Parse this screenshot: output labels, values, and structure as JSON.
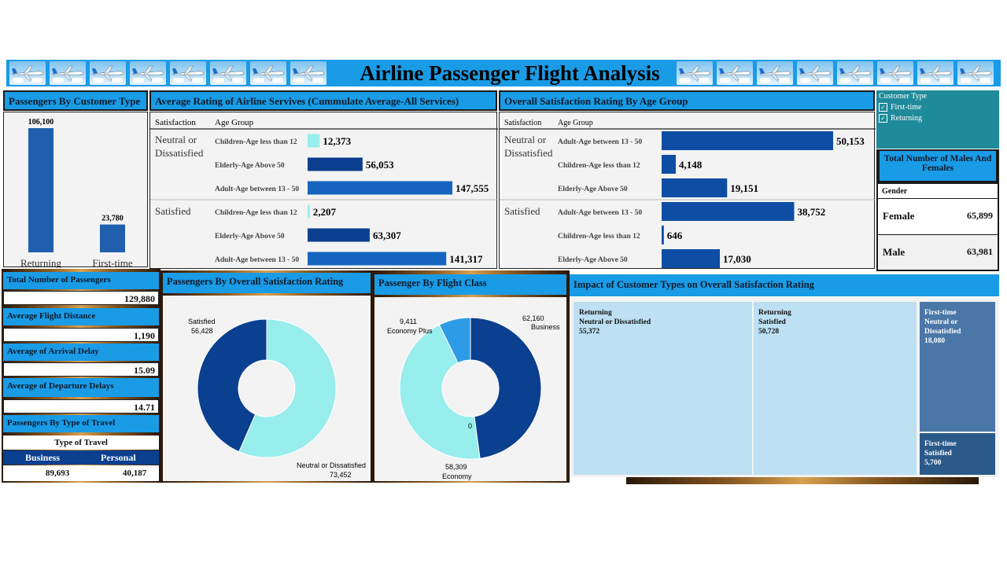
{
  "title": "Airline Passenger Flight Analysis",
  "panels": {
    "customer_type": "Passengers By Customer Type",
    "services": "Average Rating of Airline Servives (Cummulate Average-All Services)",
    "age_group": "Overall Satisfaction Rating By Age Group",
    "total_passengers": "Total Number of Passengers",
    "avg_distance": "Average Flight Distance",
    "avg_arrival": "Average of Arrival Delay",
    "avg_departure": "Average of Departure Delays",
    "type_travel": "Passengers By Type of Travel",
    "overall_sat": "Passengers By Overall Satisfaction Rating",
    "flight_class": "Passenger By Flight Class",
    "impact": "Impact of Customer Types on Overall Satisfaction Rating",
    "gender": "Total Number of Males And Females"
  },
  "kpis": {
    "total_passengers": "129,880",
    "avg_distance": "1,190",
    "avg_arrival": "15.09",
    "avg_departure": "14.71"
  },
  "filter": {
    "title": "Customer Type",
    "options": [
      "First-time",
      "Returning"
    ],
    "check": "✓"
  },
  "gender": {
    "header": "Gender",
    "rows": [
      {
        "label": "Female",
        "value": "65,899"
      },
      {
        "label": "Male",
        "value": "63,981"
      }
    ]
  },
  "type_travel": {
    "header": "Type of Travel",
    "cols": [
      "Business",
      "Personal"
    ],
    "values": [
      "89,693",
      "40,187"
    ]
  },
  "colors": {
    "accent": "#1a9be6",
    "dark_blue": "#0b3f8f",
    "mid_blue": "#1565c0",
    "light_cyan": "#98eded",
    "sky": "#2e9be6",
    "tile_light": "#bde0f2",
    "tile_mid": "#4a77a8",
    "tile_dark": "#2b5a8a"
  },
  "chart_data": [
    {
      "id": "customer_type",
      "type": "bar",
      "categories": [
        "Returning",
        "First-time"
      ],
      "values": [
        106100,
        23780
      ],
      "labels": [
        "106,100",
        "23,780"
      ],
      "ylim": [
        0,
        106100
      ]
    },
    {
      "id": "services",
      "type": "bar",
      "orientation": "horizontal",
      "col_headers": [
        "Satisfaction",
        "Age Group"
      ],
      "groups": [
        "Neutral or Dissatisfied",
        "Satisfied"
      ],
      "rows": [
        {
          "group": 0,
          "category": "Children-Age less than 12",
          "value": 12373,
          "label": "12,373",
          "color": "#98eded"
        },
        {
          "group": 0,
          "category": "Elderly-Age Above 50",
          "value": 56053,
          "label": "56,053",
          "color": "#0b3f8f"
        },
        {
          "group": 0,
          "category": "Adult-Age between 13 - 50",
          "value": 147555,
          "label": "147,555",
          "color": "#1565c0"
        },
        {
          "group": 1,
          "category": "Children-Age less than 12",
          "value": 2207,
          "label": "2,207",
          "color": "#98eded"
        },
        {
          "group": 1,
          "category": "Elderly-Age Above 50",
          "value": 63307,
          "label": "63,307",
          "color": "#0b3f8f"
        },
        {
          "group": 1,
          "category": "Adult-Age between 13 - 50",
          "value": 141317,
          "label": "141,317",
          "color": "#1565c0"
        }
      ],
      "xlim": [
        0,
        147555
      ]
    },
    {
      "id": "age_group",
      "type": "bar",
      "orientation": "horizontal",
      "col_headers": [
        "Satisfaction",
        "Age Group"
      ],
      "groups": [
        "Neutral or Dissatisfied",
        "Satisfied"
      ],
      "rows": [
        {
          "group": 0,
          "category": "Adult-Age between 13 - 50",
          "value": 50153,
          "label": "50,153"
        },
        {
          "group": 0,
          "category": "Children-Age less than 12",
          "value": 4148,
          "label": "4,148"
        },
        {
          "group": 0,
          "category": "Elderly-Age Above 50",
          "value": 19151,
          "label": "19,151"
        },
        {
          "group": 1,
          "category": "Adult-Age between 13 - 50",
          "value": 38752,
          "label": "38,752"
        },
        {
          "group": 1,
          "category": "Children-Age less than 12",
          "value": 646,
          "label": "646"
        },
        {
          "group": 1,
          "category": "Elderly-Age Above 50",
          "value": 17030,
          "label": "17,030"
        }
      ],
      "xlim": [
        0,
        50153
      ]
    },
    {
      "id": "overall_sat",
      "type": "pie",
      "donut": true,
      "slices": [
        {
          "name": "Satisfied",
          "value": 56428,
          "label": "56,428",
          "color": "#0b3f8f"
        },
        {
          "name": "Neutral or Dissatisfied",
          "value": 73452,
          "label": "73,452",
          "color": "#98eded"
        }
      ]
    },
    {
      "id": "flight_class",
      "type": "pie",
      "donut": true,
      "slices": [
        {
          "name": "Business",
          "value": 62160,
          "label": "62,160",
          "color": "#0b3f8f"
        },
        {
          "name": "Economy",
          "value": 58309,
          "label": "58,309",
          "color": "#98eded"
        },
        {
          "name": "Economy Plus",
          "value": 9411,
          "label": "9,411",
          "color": "#2e9be6"
        }
      ],
      "annotations": [
        "0"
      ]
    },
    {
      "id": "impact",
      "type": "treemap",
      "tiles": [
        {
          "line1": "Returning",
          "line2": "Neutral or Dissatisfied",
          "value": "55,372"
        },
        {
          "line1": "Returning",
          "line2": "Satisfied",
          "value": "50,728"
        },
        {
          "line1": "First-time",
          "line2": "Neutral or Dissatisfied",
          "value": "18,080"
        },
        {
          "line1": "First-time",
          "line2": "Satisfied",
          "value": "5,700"
        }
      ]
    }
  ]
}
